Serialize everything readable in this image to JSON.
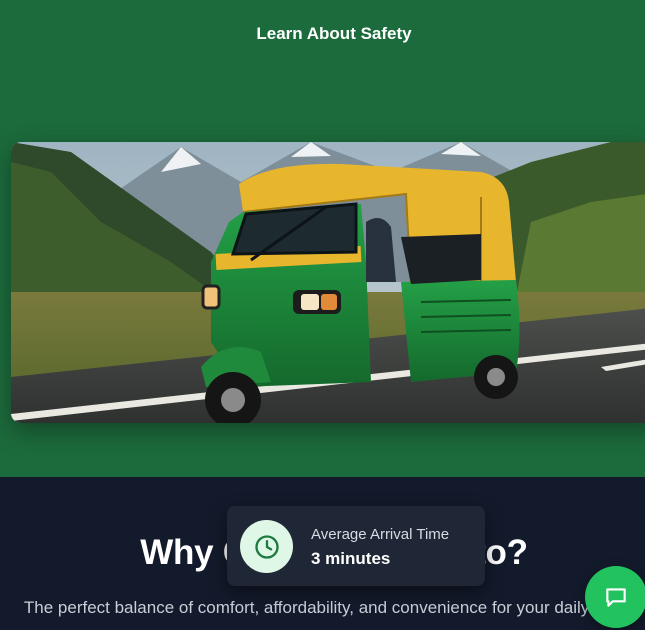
{
  "header": {
    "safety_link": "Learn About Safety"
  },
  "hero": {
    "image_alt": "Green and yellow auto rickshaw driving on a mountain road",
    "image_icon": "auto-rickshaw-photo"
  },
  "why_section": {
    "heading": "Why Choose Our Auto?",
    "tagline": "The perfect balance of comfort, affordability, and convenience for your daily travels"
  },
  "toast": {
    "icon": "clock-icon",
    "label": "Average Arrival Time",
    "value": "3 minutes"
  },
  "chat": {
    "icon": "chat-bubble-icon"
  },
  "colors": {
    "brand_green": "#1c6b3c",
    "dark_bg": "#131a2b",
    "accent_green": "#22c35e",
    "toast_bg": "#1f2736",
    "rickshaw_yellow": "#e8b62c",
    "rickshaw_green": "#1f8a3b"
  }
}
